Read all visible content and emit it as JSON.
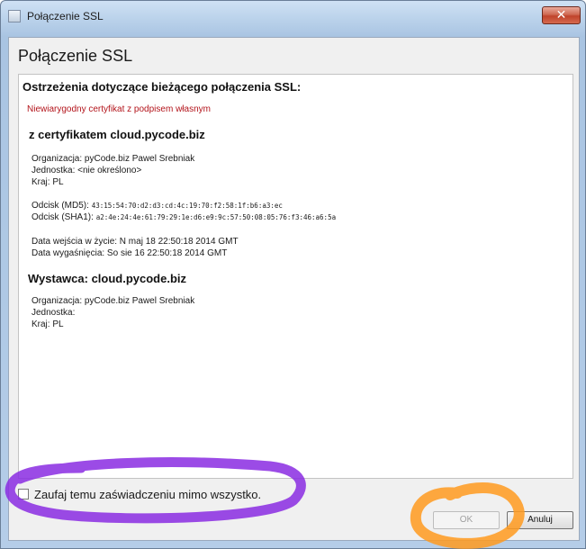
{
  "window": {
    "title": "Połączenie SSL",
    "close_label": "✕"
  },
  "dialog": {
    "heading": "Połączenie SSL",
    "warnings": {
      "heading": "Ostrzeżenia dotyczące bieżącego połączenia SSL:",
      "items": [
        "Niewiarygodny certyfikat z podpisem własnym"
      ]
    },
    "certificate": {
      "heading": "z certyfikatem cloud.pycode.biz",
      "organization": "Organizacja: pyCode.biz Pawel Srebniak",
      "unit": "Jednostka: <nie określono>",
      "country": "Kraj: PL",
      "md5_label": "Odcisk (MD5):",
      "md5_value": "43:15:54:70:d2:d3:cd:4c:19:70:f2:58:1f:b6:a3:ec",
      "sha1_label": "Odcisk (SHA1):",
      "sha1_value": "a2:4e:24:4e:61:79:29:1e:d6:e9:9c:57:50:08:05:76:f3:46:a6:5a",
      "valid_from": "Data wejścia w życie: N maj 18 22:50:18 2014 GMT",
      "valid_to": "Data wygaśnięcia: So sie 16 22:50:18 2014 GMT"
    },
    "issuer": {
      "heading": "Wystawca: cloud.pycode.biz",
      "organization": "Organizacja: pyCode.biz Pawel Srebniak",
      "unit": "Jednostka:",
      "country": "Kraj: PL"
    },
    "trust_checkbox": {
      "label": "Zaufaj temu zaświadczeniu mimo wszystko.",
      "checked": false
    },
    "buttons": {
      "ok": "OK",
      "cancel": "Anuluj"
    }
  },
  "colors": {
    "warning": "#b3141b",
    "annotation_purple": "#8a2be2",
    "annotation_orange": "#ff9a1f"
  }
}
